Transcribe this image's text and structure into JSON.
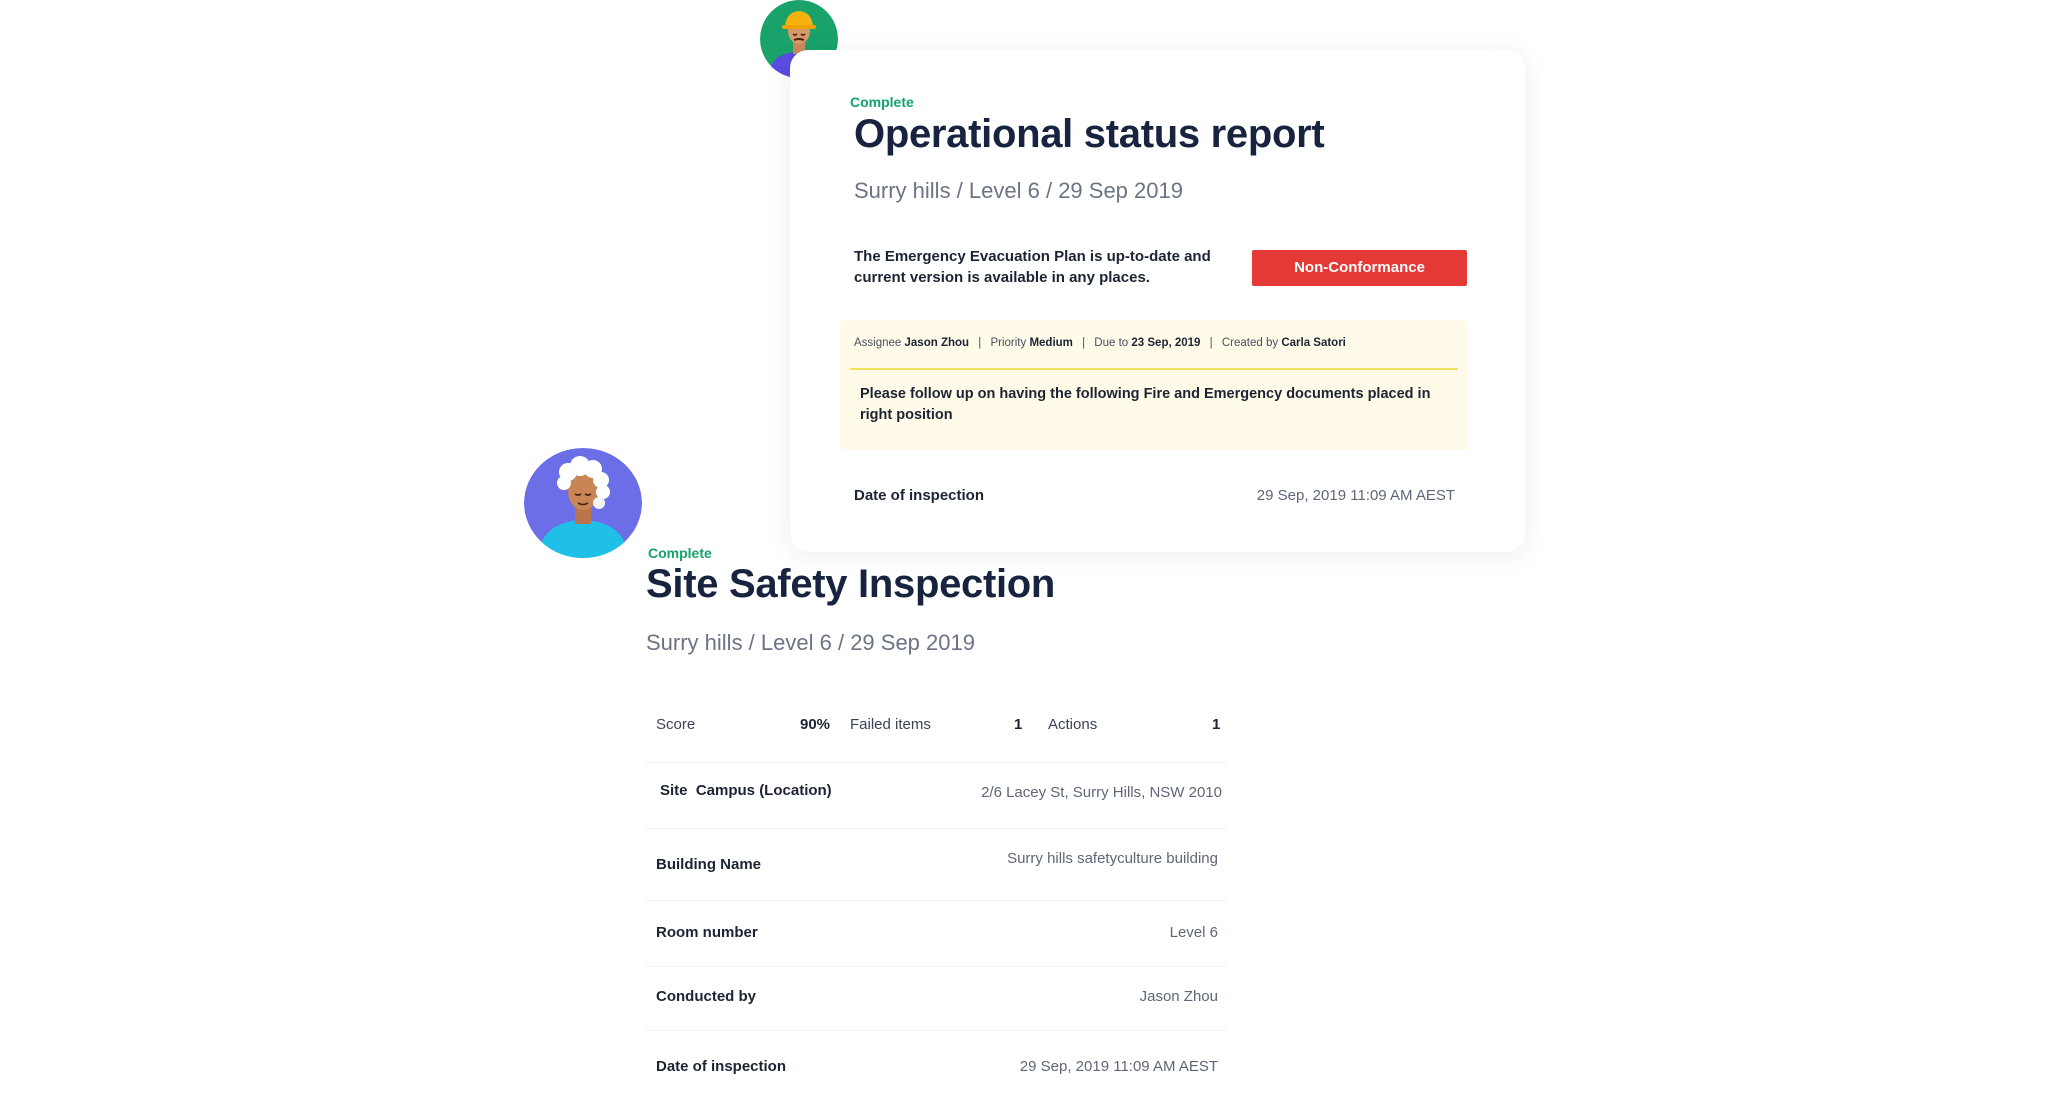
{
  "operational_report": {
    "status": "Complete",
    "title": "Operational status report",
    "subtitle": "Surry hills / Level 6 / 29 Sep 2019",
    "issue_text": "The Emergency Evacuation Plan is up-to-date and current version is available in any places.",
    "badge": "Non-Conformance",
    "action": {
      "assignee_label": "Assignee",
      "assignee": "Jason Zhou",
      "priority_label": "Priority",
      "priority": "Medium",
      "due_label": "Due to",
      "due": "23 Sep, 2019",
      "created_label": "Created by",
      "created_by": "Carla Satori",
      "separator": "|",
      "body": "Please follow up on having the following Fire and Emergency documents placed in right position"
    },
    "date_of_inspection_label": "Date of inspection",
    "date_of_inspection": "29 Sep, 2019 11:09 AM AEST"
  },
  "site_inspection": {
    "status": "Complete",
    "title": "Site Safety Inspection",
    "subtitle": "Surry hills / Level 6 / 29 Sep 2019",
    "stats": {
      "score_label": "Score",
      "score": "90%",
      "failed_label": "Failed items",
      "failed": "1",
      "actions_label": "Actions",
      "actions": "1"
    },
    "details": {
      "site_label": "Site  Campus (Location)",
      "site_value": "2/6 Lacey St, Surry Hills, NSW 2010",
      "building_label": "Building Name",
      "building_value": "Surry hills safetyculture building",
      "room_label": "Room number",
      "room_value": "Level 6",
      "conducted_label": "Conducted by",
      "conducted_value": "Jason Zhou",
      "doi_label": "Date of inspection",
      "doi_value": "29 Sep, 2019 11:09 AM AEST"
    }
  },
  "colors": {
    "complete_green": "#13a36a",
    "non_conformance_red": "#e53935",
    "action_bg": "#fffbe8",
    "title_navy": "#17233f"
  }
}
